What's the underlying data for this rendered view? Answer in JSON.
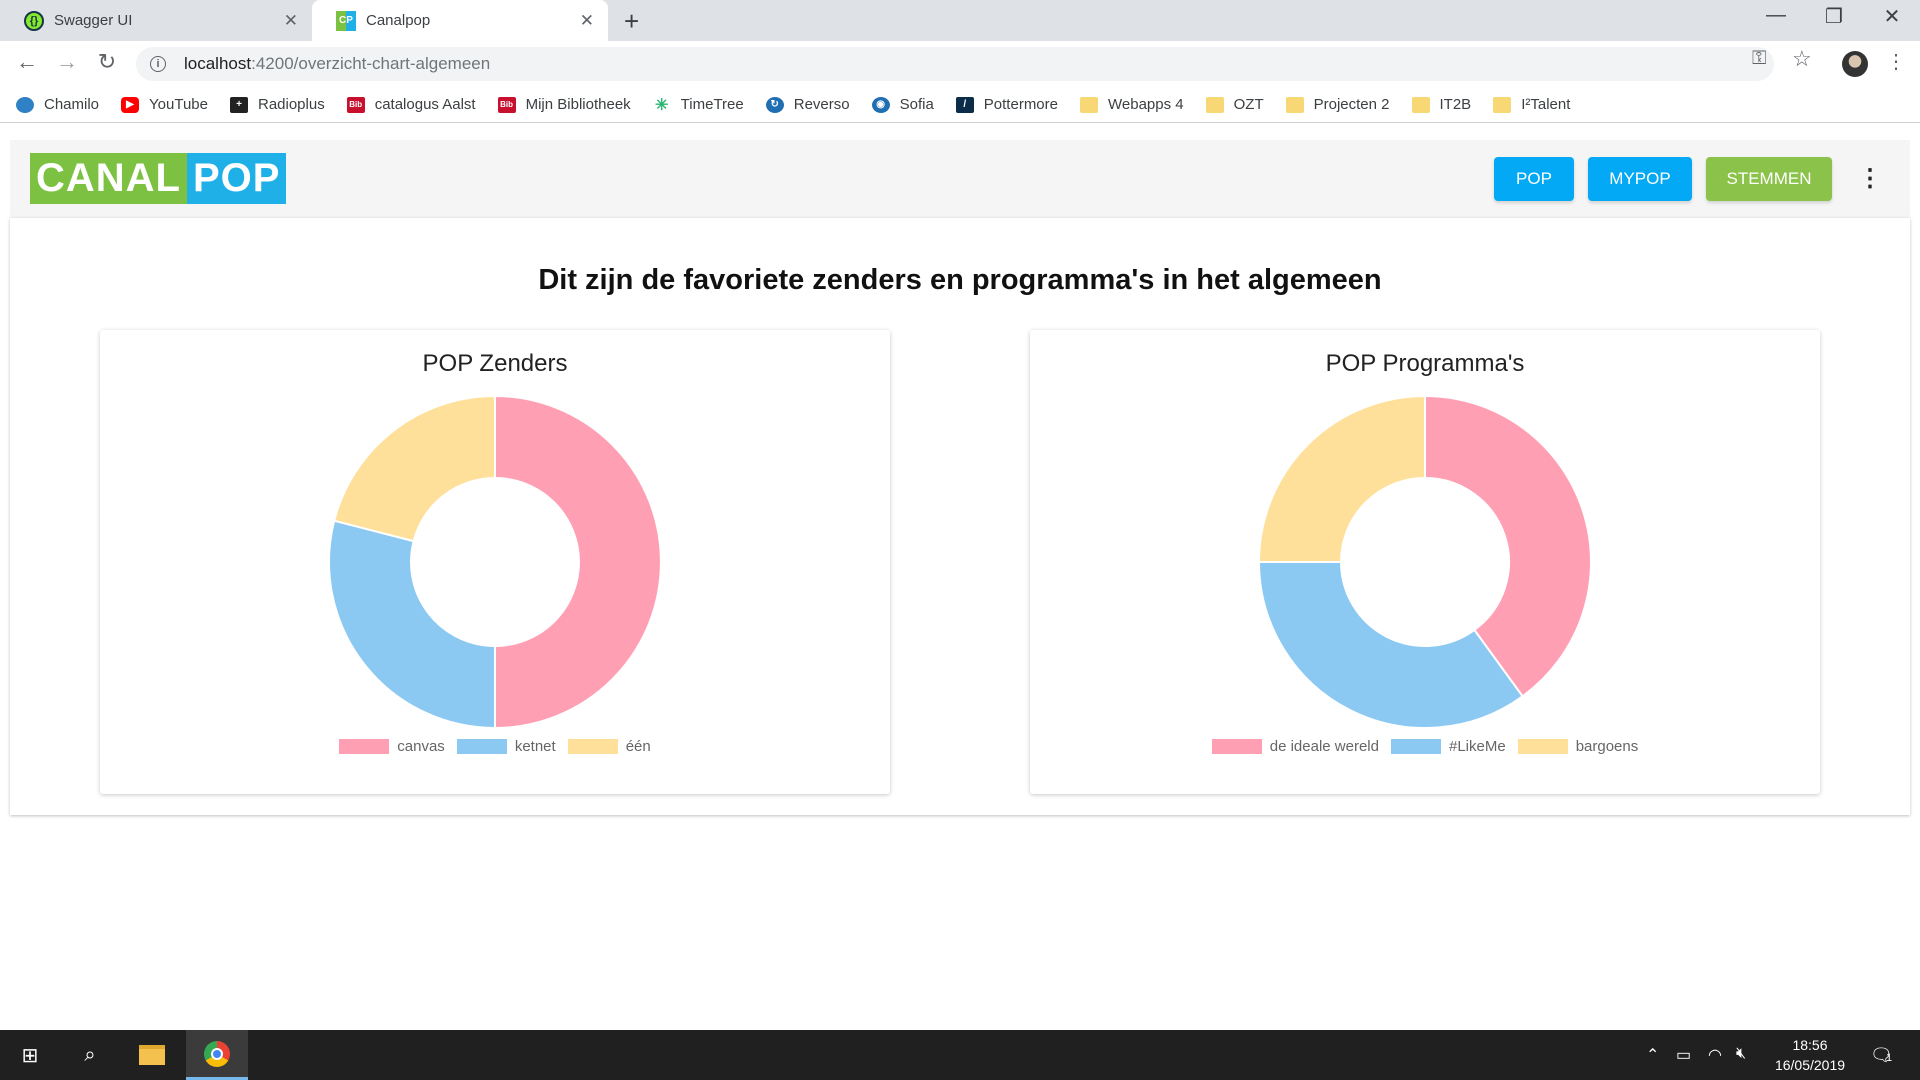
{
  "browser": {
    "tabs": [
      {
        "title": "Swagger UI",
        "icon": "swagger-icon"
      },
      {
        "title": "Canalpop",
        "icon": "canalpop-icon"
      }
    ],
    "url_host": "localhost",
    "url_path": ":4200/overzicht-chart-algemeen",
    "bookmarks": [
      {
        "label": "Chamilo",
        "icon": "chamilo-icon"
      },
      {
        "label": "YouTube",
        "icon": "youtube-icon"
      },
      {
        "label": "Radioplus",
        "icon": "radioplus-icon"
      },
      {
        "label": "catalogus Aalst",
        "icon": "bib-icon"
      },
      {
        "label": "Mijn Bibliotheek",
        "icon": "bib-icon"
      },
      {
        "label": "TimeTree",
        "icon": "timetree-icon"
      },
      {
        "label": "Reverso",
        "icon": "reverso-icon"
      },
      {
        "label": "Sofia",
        "icon": "sofia-icon"
      },
      {
        "label": "Pottermore",
        "icon": "pottermore-icon"
      },
      {
        "label": "Webapps 4",
        "icon": "folder-icon"
      },
      {
        "label": "OZT",
        "icon": "folder-icon"
      },
      {
        "label": "Projecten 2",
        "icon": "folder-icon"
      },
      {
        "label": "IT2B",
        "icon": "folder-icon"
      },
      {
        "label": "I²Talent",
        "icon": "folder-icon"
      }
    ]
  },
  "app": {
    "logo_left": "CANAL",
    "logo_right": "POP",
    "nav": {
      "pop": "POP",
      "mypop": "MYPOP",
      "stemmen": "STEMMEN"
    },
    "page_title": "Dit zijn de favoriete zenders en programma's in het algemeen",
    "colors": {
      "green": "#7dc142",
      "blue": "#03a9f4",
      "stemmen": "#8bc34a"
    }
  },
  "chart_data": [
    {
      "type": "pie",
      "title": "POP Zenders",
      "categories": [
        "canvas",
        "ketnet",
        "één"
      ],
      "values": [
        50,
        29,
        21
      ],
      "colors": [
        "#ff9fb3",
        "#8cc9f2",
        "#ffe09a"
      ],
      "legend": "bottom"
    },
    {
      "type": "pie",
      "title": "POP Programma's",
      "categories": [
        "de ideale wereld",
        "#LikeMe",
        "bargoens"
      ],
      "values": [
        40,
        35,
        25
      ],
      "colors": [
        "#ff9fb3",
        "#8cc9f2",
        "#ffe09a"
      ],
      "legend": "bottom"
    }
  ],
  "taskbar": {
    "time": "18:56",
    "date": "16/05/2019",
    "notifications": "1"
  }
}
